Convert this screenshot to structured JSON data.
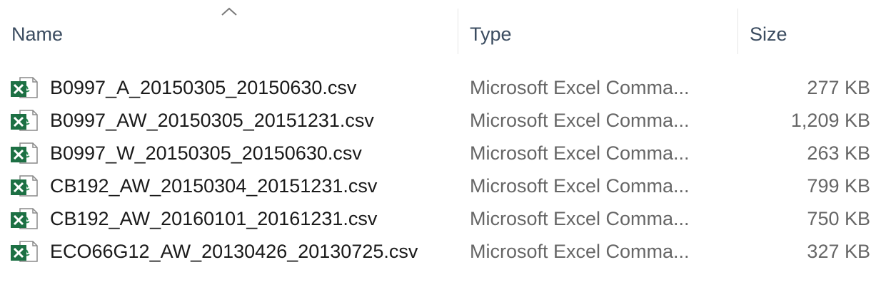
{
  "header": {
    "sort_indicator": "chevron-up-icon",
    "columns": {
      "name": "Name",
      "type": "Type",
      "size": "Size"
    }
  },
  "files": [
    {
      "name": "B0997_A_20150305_20150630.csv",
      "type": "Microsoft Excel Comma...",
      "size": "277 KB",
      "icon": "excel-csv-file-icon"
    },
    {
      "name": "B0997_AW_20150305_20151231.csv",
      "type": "Microsoft Excel Comma...",
      "size": "1,209 KB",
      "icon": "excel-csv-file-icon"
    },
    {
      "name": "B0997_W_20150305_20150630.csv",
      "type": "Microsoft Excel Comma...",
      "size": "263 KB",
      "icon": "excel-csv-file-icon"
    },
    {
      "name": "CB192_AW_20150304_20151231.csv",
      "type": "Microsoft Excel Comma...",
      "size": "799 KB",
      "icon": "excel-csv-file-icon"
    },
    {
      "name": "CB192_AW_20160101_20161231.csv",
      "type": "Microsoft Excel Comma...",
      "size": "750 KB",
      "icon": "excel-csv-file-icon"
    },
    {
      "name": "ECO66G12_AW_20130426_20130725.csv",
      "type": "Microsoft Excel Comma...",
      "size": "327 KB",
      "icon": "excel-csv-file-icon"
    }
  ],
  "colors": {
    "header_text": "#3b4c60",
    "secondary_text": "#666666",
    "excel_green": "#1d7044",
    "divider": "#e5e5e5"
  }
}
